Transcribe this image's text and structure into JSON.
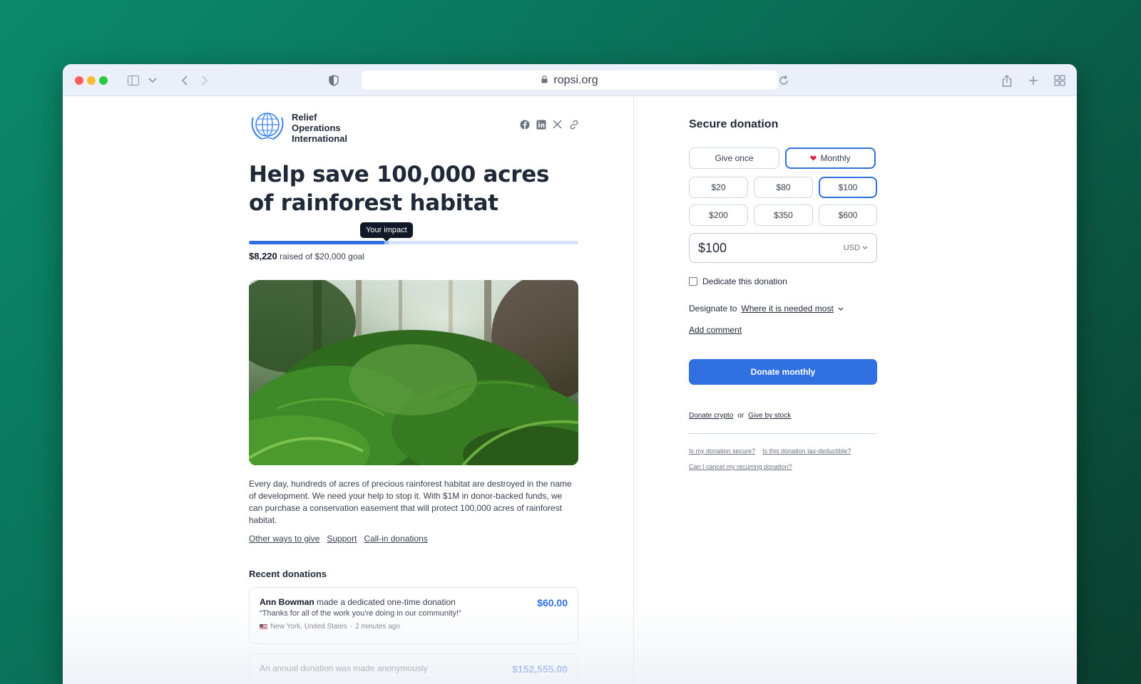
{
  "browser": {
    "url": "ropsi.org"
  },
  "org": {
    "name": "Relief Operations International"
  },
  "campaign": {
    "title": "Help save 100,000 acres of rainforest habitat",
    "impact_tooltip": "Your impact",
    "raised_amount": "$8,220",
    "raised_suffix": "raised of $20,000 goal",
    "progress_raised_fraction": 0.411,
    "progress_impact_fraction": 0.005,
    "description": "Every day, hundreds of acres of precious rainforest habitat are destroyed in the name of development. We need your help to stop it. With $1M in donor-backed funds, we can purchase a conservation easement that will protect 100,000 acres of rainforest habitat.",
    "links": [
      "Other ways to give",
      "Support",
      "Call-in donations"
    ]
  },
  "recent": {
    "heading": "Recent donations",
    "items": [
      {
        "name": "Ann Bowman",
        "action": "made a dedicated one-time donation",
        "amount": "$60.00",
        "quote": "“Thanks for all of the work you're doing in our community!”",
        "location": "New York, United States",
        "time": "2 minutes ago"
      },
      {
        "name": "",
        "action": "An annual donation was made anonymously",
        "amount": "$152,555.00"
      }
    ]
  },
  "donation": {
    "title": "Secure donation",
    "frequency": {
      "once": "Give once",
      "monthly": "Monthly",
      "selected": "monthly"
    },
    "amounts": [
      "$20",
      "$80",
      "$100",
      "$200",
      "$350",
      "$600"
    ],
    "selected_amount": "$100",
    "amount_value": "$100",
    "currency": "USD",
    "dedicate_label": "Dedicate this donation",
    "dedicate_checked": false,
    "designate_label": "Designate to",
    "designate_value": "Where it is needed most",
    "add_comment": "Add comment",
    "submit": "Donate monthly",
    "crypto": "Donate crypto",
    "or": "or",
    "stock": "Give by stock",
    "faq": [
      "Is my donation secure?",
      "Is this donation tax-deductible?",
      "Can I cancel my recurring donation?"
    ]
  },
  "colors": {
    "accent": "#2f6fe0",
    "heart": "#e11d48"
  }
}
